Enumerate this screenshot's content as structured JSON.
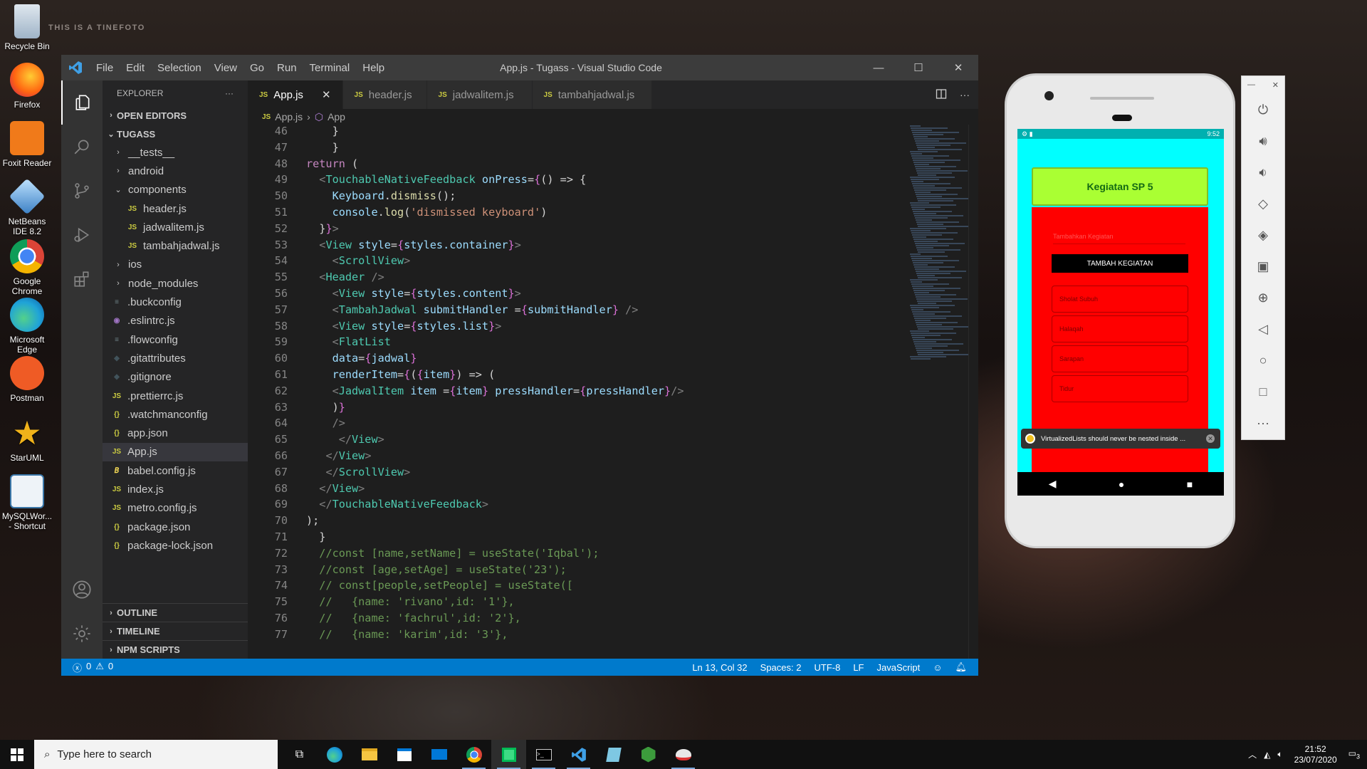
{
  "desktop": {
    "wallpaper_text": "THIS IS A TINEFOTO",
    "icons": [
      {
        "label": "Recycle Bin",
        "icon": "recycle-bin-icon",
        "color": "#9fb4c8"
      },
      {
        "label": "Firefox",
        "icon": "firefox-icon",
        "color": "#ff6611"
      },
      {
        "label": "Foxit Reader",
        "icon": "foxit-reader-icon",
        "color": "#f07a1a"
      },
      {
        "label": "NetBeans IDE 8.2",
        "icon": "netbeans-icon",
        "color": "#5aa0e0"
      },
      {
        "label": "Google Chrome",
        "icon": "chrome-icon",
        "color": "#db4437"
      },
      {
        "label": "Microsoft Edge",
        "icon": "edge-icon",
        "color": "#1fa3d8"
      },
      {
        "label": "Postman",
        "icon": "postman-icon",
        "color": "#ef5b25"
      },
      {
        "label": "StarUML",
        "icon": "staruml-icon",
        "color": "#f0b21a"
      },
      {
        "label": "MySQLWor... - Shortcut",
        "icon": "mysql-workbench-icon",
        "color": "#3a76a8"
      }
    ]
  },
  "vscode": {
    "menu": [
      "File",
      "Edit",
      "Selection",
      "View",
      "Go",
      "Run",
      "Terminal",
      "Help"
    ],
    "window_title": "App.js - Tugass - Visual Studio Code",
    "explorer": {
      "title": "EXPLORER",
      "open_editors": "OPEN EDITORS",
      "project": "TUGASS",
      "tree": [
        {
          "label": "__tests__",
          "type": "folder",
          "depth": 1,
          "chev": "›"
        },
        {
          "label": "android",
          "type": "folder",
          "depth": 1,
          "chev": "›"
        },
        {
          "label": "components",
          "type": "folder",
          "depth": 1,
          "chev": "⌄"
        },
        {
          "label": "header.js",
          "type": "js",
          "depth": 2
        },
        {
          "label": "jadwalitem.js",
          "type": "js",
          "depth": 2
        },
        {
          "label": "tambahjadwal.js",
          "type": "js",
          "depth": 2
        },
        {
          "label": "ios",
          "type": "folder",
          "depth": 1,
          "chev": "›"
        },
        {
          "label": "node_modules",
          "type": "folder",
          "depth": 1,
          "chev": "›"
        },
        {
          "label": ".buckconfig",
          "type": "cfg",
          "depth": 1
        },
        {
          "label": ".eslintrc.js",
          "type": "esl",
          "depth": 1
        },
        {
          "label": ".flowconfig",
          "type": "cfg",
          "depth": 1
        },
        {
          "label": ".gitattributes",
          "type": "git",
          "depth": 1
        },
        {
          "label": ".gitignore",
          "type": "git",
          "depth": 1
        },
        {
          "label": ".prettierrc.js",
          "type": "js",
          "depth": 1
        },
        {
          "label": ".watchmanconfig",
          "type": "json",
          "depth": 1
        },
        {
          "label": "app.json",
          "type": "json",
          "depth": 1
        },
        {
          "label": "App.js",
          "type": "js",
          "depth": 1,
          "selected": true
        },
        {
          "label": "babel.config.js",
          "type": "babel",
          "depth": 1
        },
        {
          "label": "index.js",
          "type": "js",
          "depth": 1
        },
        {
          "label": "metro.config.js",
          "type": "js",
          "depth": 1
        },
        {
          "label": "package.json",
          "type": "json",
          "depth": 1
        },
        {
          "label": "package-lock.json",
          "type": "json",
          "depth": 1
        }
      ],
      "outline": "OUTLINE",
      "timeline": "TIMELINE",
      "npm_scripts": "NPM SCRIPTS"
    },
    "tabs": [
      "App.js",
      "header.js",
      "jadwalitem.js",
      "tambahjadwal.js"
    ],
    "breadcrumb": [
      "App.js",
      "App"
    ],
    "code_lines": [
      {
        "n": "46",
        "html": "    <span class=\"p\">}</span>"
      },
      {
        "n": "47",
        "html": "    <span class=\"p\">}</span>"
      },
      {
        "n": "48",
        "html": "<span class=\"k\">return</span> <span class=\"p\">(</span>"
      },
      {
        "n": "49",
        "html": "  <span class=\"tg\">&lt;</span><span class=\"t\">TouchableNativeFeedback</span> <span class=\"a\">onPress</span><span class=\"p\">=</span><span class=\"br\">{</span><span class=\"p\">() =&gt; {</span>"
      },
      {
        "n": "50",
        "html": "    <span class=\"v\">Keyboard</span><span class=\"p\">.</span><span class=\"f\">dismiss</span><span class=\"p\">();</span>"
      },
      {
        "n": "51",
        "html": "    <span class=\"v\">console</span><span class=\"p\">.</span><span class=\"f\">log</span><span class=\"p\">(</span><span class=\"s\">'dismissed keyboard'</span><span class=\"p\">)</span>"
      },
      {
        "n": "52",
        "html": "  <span class=\"p\">}</span><span class=\"br\">}</span><span class=\"tg\">&gt;</span>"
      },
      {
        "n": "53",
        "html": "  <span class=\"tg\">&lt;</span><span class=\"t\">View</span> <span class=\"a\">style</span><span class=\"p\">=</span><span class=\"br\">{</span><span class=\"v\">styles.container</span><span class=\"br\">}</span><span class=\"tg\">&gt;</span>"
      },
      {
        "n": "54",
        "html": "    <span class=\"tg\">&lt;</span><span class=\"t\">ScrollView</span><span class=\"tg\">&gt;</span>"
      },
      {
        "n": "55",
        "html": "  <span class=\"tg\">&lt;</span><span class=\"t\">Header</span> <span class=\"tg\">/&gt;</span>"
      },
      {
        "n": "56",
        "html": "    <span class=\"tg\">&lt;</span><span class=\"t\">View</span> <span class=\"a\">style</span><span class=\"p\">=</span><span class=\"br\">{</span><span class=\"v\">styles.content</span><span class=\"br\">}</span><span class=\"tg\">&gt;</span>"
      },
      {
        "n": "57",
        "html": "    <span class=\"tg\">&lt;</span><span class=\"t\">TambahJadwal</span> <span class=\"a\">submitHandler</span> <span class=\"p\">=</span><span class=\"br\">{</span><span class=\"v\">submitHandler</span><span class=\"br\">}</span> <span class=\"tg\">/&gt;</span>"
      },
      {
        "n": "58",
        "html": "    <span class=\"tg\">&lt;</span><span class=\"t\">View</span> <span class=\"a\">style</span><span class=\"p\">=</span><span class=\"br\">{</span><span class=\"v\">styles.list</span><span class=\"br\">}</span><span class=\"tg\">&gt;</span>"
      },
      {
        "n": "59",
        "html": "    <span class=\"tg\">&lt;</span><span class=\"t\">FlatList</span>"
      },
      {
        "n": "60",
        "html": "    <span class=\"a\">data</span><span class=\"p\">=</span><span class=\"br\">{</span><span class=\"v\">jadwal</span><span class=\"br\">}</span>"
      },
      {
        "n": "61",
        "html": "    <span class=\"a\">renderItem</span><span class=\"p\">=</span><span class=\"br\">{</span><span class=\"p\">(</span><span class=\"br\">{</span><span class=\"v\">item</span><span class=\"br\">}</span><span class=\"p\">) =&gt; (</span>"
      },
      {
        "n": "62",
        "html": "    <span class=\"tg\">&lt;</span><span class=\"t\">JadwalItem</span> <span class=\"a\">item</span> <span class=\"p\">=</span><span class=\"br\">{</span><span class=\"v\">item</span><span class=\"br\">}</span> <span class=\"a\">pressHandler</span><span class=\"p\">=</span><span class=\"br\">{</span><span class=\"v\">pressHandler</span><span class=\"br\">}</span><span class=\"tg\">/&gt;</span>"
      },
      {
        "n": "63",
        "html": "    <span class=\"p\">)</span><span class=\"br\">}</span>"
      },
      {
        "n": "64",
        "html": "    <span class=\"tg\">/&gt;</span>"
      },
      {
        "n": "65",
        "html": "     <span class=\"tg\">&lt;/</span><span class=\"t\">View</span><span class=\"tg\">&gt;</span>"
      },
      {
        "n": "66",
        "html": "   <span class=\"tg\">&lt;/</span><span class=\"t\">View</span><span class=\"tg\">&gt;</span>"
      },
      {
        "n": "67",
        "html": "   <span class=\"tg\">&lt;/</span><span class=\"t\">ScrollView</span><span class=\"tg\">&gt;</span>"
      },
      {
        "n": "68",
        "html": "  <span class=\"tg\">&lt;/</span><span class=\"t\">View</span><span class=\"tg\">&gt;</span>"
      },
      {
        "n": "69",
        "html": "  <span class=\"tg\">&lt;/</span><span class=\"t\">TouchableNativeFeedback</span><span class=\"tg\">&gt;</span>"
      },
      {
        "n": "70",
        "html": "<span class=\"p\">);</span>"
      },
      {
        "n": "71",
        "html": "  <span class=\"p\">}</span>"
      },
      {
        "n": "72",
        "html": "  <span class=\"c\">//const [name,setName] = useState('Iqbal');</span>"
      },
      {
        "n": "73",
        "html": "  <span class=\"c\">//const [age,setAge] = useState('23');</span>"
      },
      {
        "n": "74",
        "html": "  <span class=\"c\">// const[people,setPeople] = useState([</span>"
      },
      {
        "n": "75",
        "html": "  <span class=\"c\">//   {name: 'rivano',id: '1'},</span>"
      },
      {
        "n": "76",
        "html": "  <span class=\"c\">//   {name: 'fachrul',id: '2'},</span>"
      },
      {
        "n": "77",
        "html": "  <span class=\"c\">//   {name: 'karim',id: '3'},</span>"
      }
    ],
    "status": {
      "errors": "0",
      "warnings": "0",
      "position": "Ln 13, Col 32",
      "spaces": "Spaces: 2",
      "encoding": "UTF-8",
      "eol": "LF",
      "language": "JavaScript"
    }
  },
  "emulator": {
    "time": "9:52",
    "app_title": "Kegiatan SP 5",
    "input_placeholder": "Tambahkan Kegiatan",
    "add_button": "TAMBAH KEGIATAN",
    "items": [
      "Sholat Subuh",
      "Halaqah",
      "Sarapan",
      "Tidur"
    ],
    "toast": "VirtualizedLists should never be nested inside ...",
    "colors": {
      "bg": "#00ffff",
      "header": "#aaff33",
      "list": "#ff0000"
    }
  },
  "taskbar": {
    "search_placeholder": "Type here to search",
    "time": "21:52",
    "date": "23/07/2020",
    "notifications": "3"
  }
}
